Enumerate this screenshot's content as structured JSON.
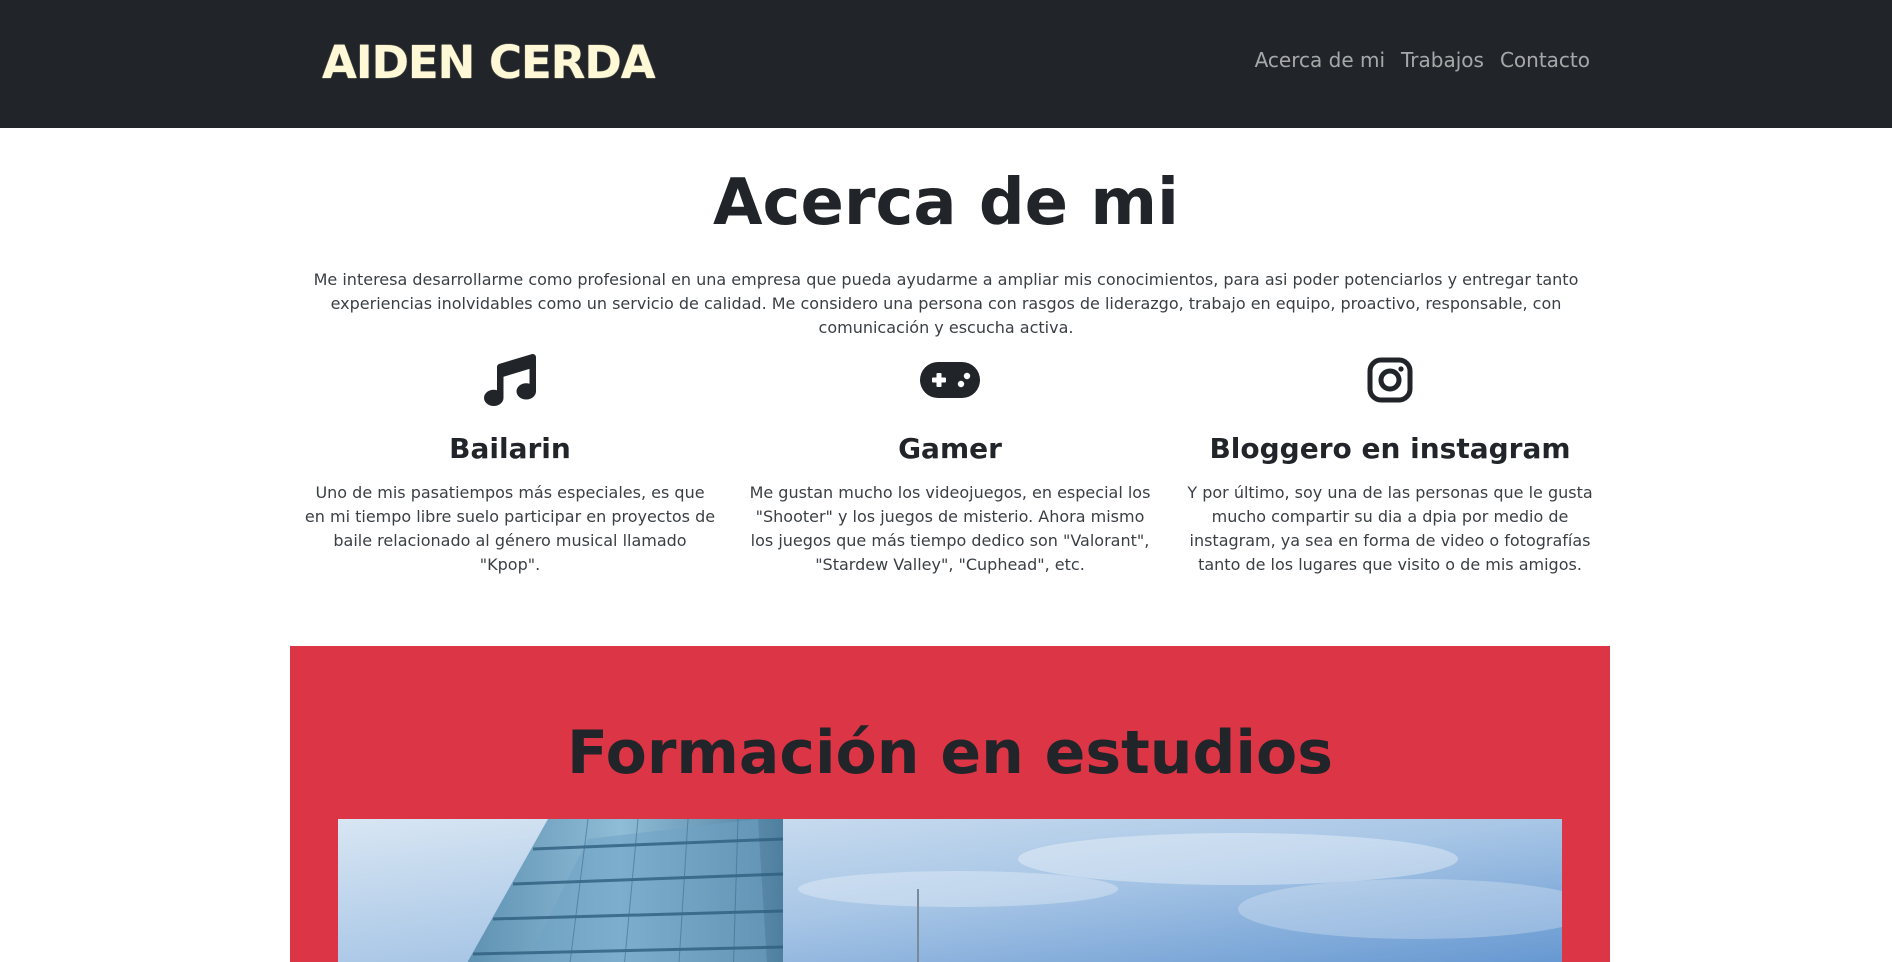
{
  "navbar": {
    "brand": "AIDEN CERDA",
    "links": [
      {
        "label": "Acerca de mi"
      },
      {
        "label": "Trabajos"
      },
      {
        "label": "Contacto"
      }
    ]
  },
  "about": {
    "title": "Acerca de mi",
    "text": "Me interesa desarrollarme como profesional en una empresa que pueda ayudarme a ampliar mis conocimientos, para asi poder potenciarlos y entregar tanto experiencias inolvidables como un servicio de calidad. Me considero una persona con rasgos de liderazgo, trabajo en equipo, proactivo, responsable, con comunicación y escucha activa.",
    "features": [
      {
        "icon": "music-note-icon",
        "title": "Bailarin",
        "text": "Uno de mis pasatiempos más especiales, es que en mi tiempo libre suelo participar en proyectos de baile relacionado al género musical llamado \"Kpop\"."
      },
      {
        "icon": "gamepad-icon",
        "title": "Gamer",
        "text": "Me gustan mucho los videojuegos, en especial los \"Shooter\" y los juegos de misterio. Ahora mismo los juegos que más tiempo dedico son \"Valorant\", \"Stardew Valley\", \"Cuphead\", etc."
      },
      {
        "icon": "instagram-icon",
        "title": "Bloggero en instagram",
        "text": "Y por último, soy una de las personas que le gusta mucho compartir su dia a dpia por medio de instagram, ya sea en forma de video o fotografías tanto de los lugares que visito o de mis amigos."
      }
    ]
  },
  "studies": {
    "title": "Formación en estudios",
    "photo_icon": "building-photo"
  },
  "colors": {
    "navbar_bg": "#212529",
    "brand": "#fff8d6",
    "studies_bg": "#dc3545"
  }
}
